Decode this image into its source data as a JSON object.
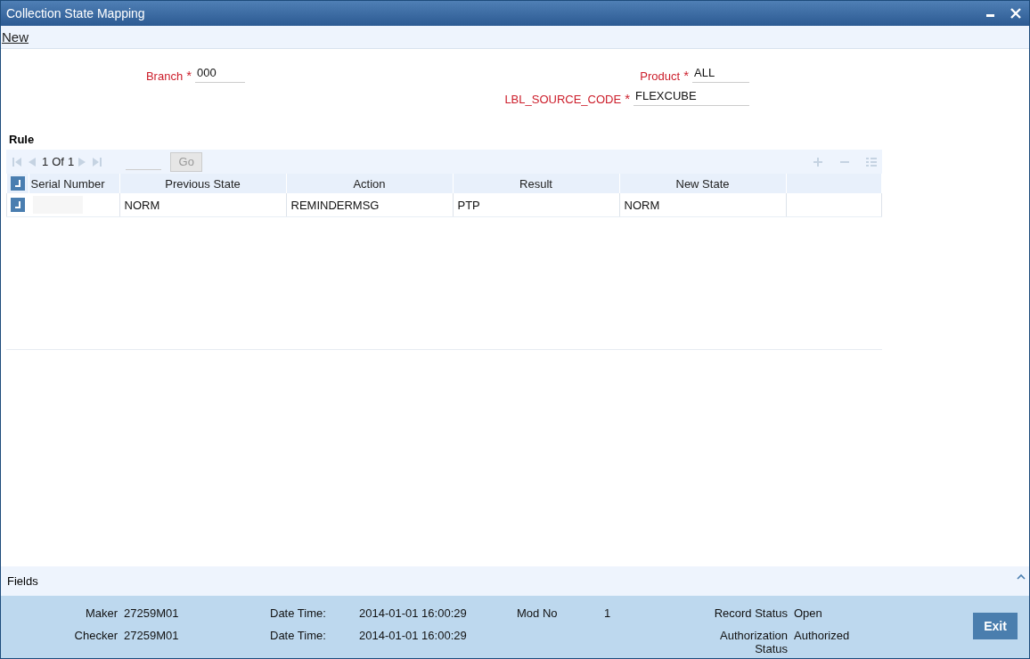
{
  "window": {
    "title": "Collection State Mapping"
  },
  "toolbar": {
    "actions": [
      "New"
    ]
  },
  "form": {
    "left": [
      {
        "label": "Branch",
        "required_mark": "*",
        "value": "000"
      }
    ],
    "right": [
      {
        "label": "Product",
        "required_mark": "*",
        "value": "ALL"
      },
      {
        "label": "LBL_SOURCE_CODE",
        "required_mark": "*",
        "value": "FLEXCUBE"
      }
    ]
  },
  "rule": {
    "title": "Rule",
    "pager": {
      "current": "1",
      "of": "Of",
      "total": "1",
      "go": "Go"
    },
    "columns": [
      "Serial Number",
      "Previous State",
      "Action",
      "Result",
      "New State"
    ],
    "rows": [
      {
        "cells": [
          "",
          "NORM",
          "REMINDERMSG",
          "PTP",
          "NORM"
        ]
      }
    ]
  },
  "fields_bar": {
    "label": "Fields"
  },
  "audit": {
    "rows": [
      [
        {
          "label": "Maker",
          "value": "27259M01"
        },
        {
          "label": "Date Time:",
          "value": "2014-01-01 16:00:29"
        },
        {
          "label": "Mod No",
          "value": "1"
        },
        {
          "label": "Record Status",
          "value": "Open"
        }
      ],
      [
        {
          "label": "Checker",
          "value": "27259M01"
        },
        {
          "label": "Date Time:",
          "value": "2014-01-01 16:00:29"
        },
        null,
        {
          "label": "Authorization Status",
          "value": "Authorized"
        }
      ]
    ],
    "button": "Exit"
  }
}
